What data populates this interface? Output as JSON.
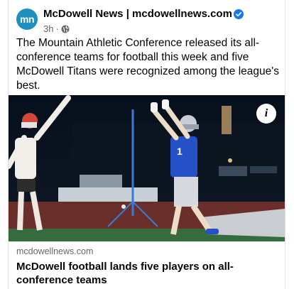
{
  "post": {
    "avatar_text": "mn",
    "page_name": "McDowell News | mcdowellnews.com",
    "timestamp": "3h",
    "separator": "·",
    "text": "The Mountain Athletic Conference released its all-conference teams for football this week and five McDowell Titans were recognized among the league's best."
  },
  "photo": {
    "player_number": "1",
    "info_icon": "i"
  },
  "link_preview": {
    "domain": "mcdowellnews.com",
    "title": "McDowell football lands five players on all-conference teams"
  },
  "colors": {
    "brand": "#1f8fbf",
    "verified": "#1877f2",
    "muted_text": "#65676b",
    "titans_blue": "#2450c8",
    "opponent_red": "#d2473c"
  },
  "icons": {
    "verified": "verified-badge-icon",
    "audience": "globe-icon",
    "info": "info-icon"
  }
}
